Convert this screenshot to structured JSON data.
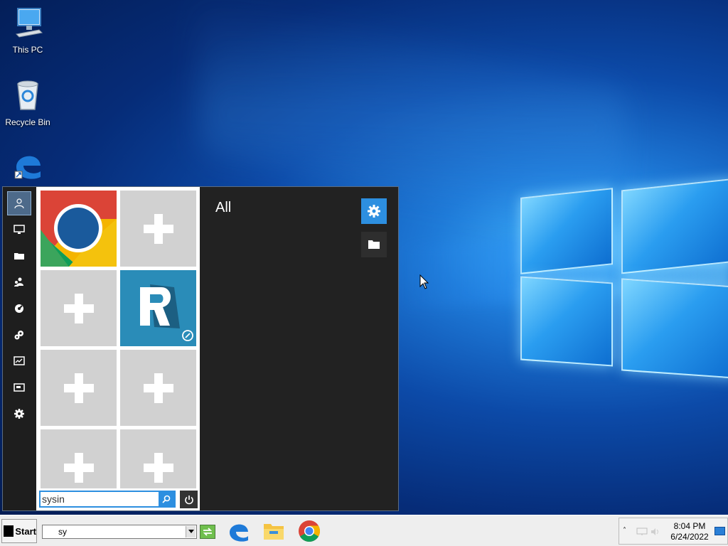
{
  "desktop": {
    "icons": [
      {
        "label": "This PC",
        "icon": "computer-icon"
      },
      {
        "label": "Recycle Bin",
        "icon": "recycle-bin-icon"
      },
      {
        "label": "",
        "icon": "edge-shortcut-icon"
      }
    ]
  },
  "start_menu": {
    "rail": [
      {
        "icon": "user-icon",
        "active": true
      },
      {
        "icon": "monitor-icon"
      },
      {
        "icon": "folder-icon"
      },
      {
        "icon": "users-icon"
      },
      {
        "icon": "network-icon"
      },
      {
        "icon": "gears-icon"
      },
      {
        "icon": "performance-icon"
      },
      {
        "icon": "display-icon"
      },
      {
        "icon": "settings-icon"
      }
    ],
    "tiles": [
      {
        "type": "chrome-app",
        "icon": "chrome-icon"
      },
      {
        "type": "add",
        "icon": "plus-icon"
      },
      {
        "type": "add",
        "icon": "plus-icon"
      },
      {
        "type": "app",
        "icon": "r-app-icon"
      },
      {
        "type": "add",
        "icon": "plus-icon"
      },
      {
        "type": "add",
        "icon": "plus-icon"
      },
      {
        "type": "add",
        "icon": "plus-icon"
      },
      {
        "type": "add",
        "icon": "plus-icon"
      }
    ],
    "search": {
      "value": "sysin"
    },
    "right_panel": {
      "title": "All"
    }
  },
  "taskbar": {
    "start_label": "Start",
    "run_value": "sy",
    "apps": [
      "edge-icon",
      "file-explorer-icon",
      "chrome-icon"
    ],
    "clock": {
      "time": "8:04 PM",
      "date": "6/24/2022"
    }
  },
  "colors": {
    "accent": "#2d8fe0",
    "menu_bg": "#222222",
    "tile_gray": "#d1d1d1"
  }
}
